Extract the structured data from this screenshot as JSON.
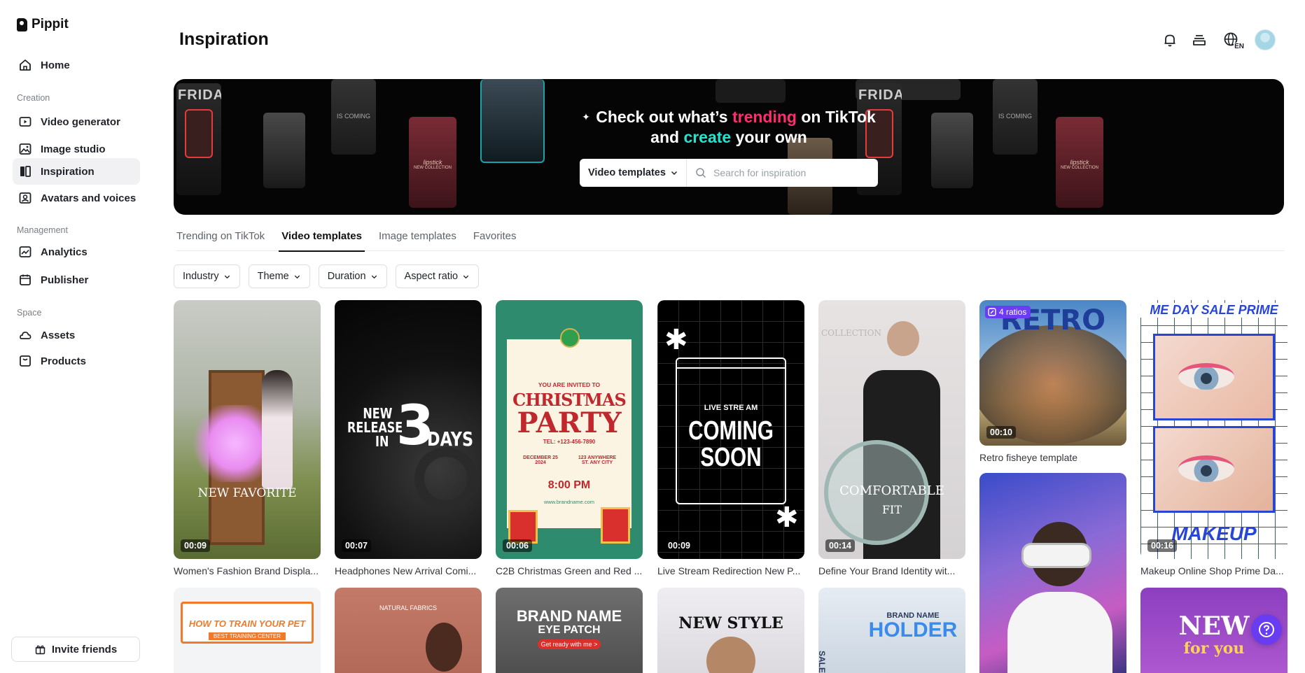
{
  "app": {
    "name": "Pippit"
  },
  "sidebar": {
    "home": "Home",
    "sections": {
      "creation": "Creation",
      "management": "Management",
      "space": "Space"
    },
    "creation_items": [
      "Video generator",
      "Image studio",
      "Inspiration",
      "Avatars and voices"
    ],
    "management_items": [
      "Analytics",
      "Publisher"
    ],
    "space_items": [
      "Assets",
      "Products"
    ],
    "invite_label": "Invite friends"
  },
  "header": {
    "title": "Inspiration",
    "language": "EN"
  },
  "banner": {
    "line1_pre": "Check out what’s ",
    "line1_highlight": "trending",
    "line1_post": " on TikTok",
    "line2_pre": "and ",
    "line2_highlight": "create",
    "line2_post": " your own",
    "search_select": "Video templates",
    "search_placeholder": "Search for inspiration",
    "tile_texts": {
      "friday": "FRIDAY",
      "coming": "IS COMING",
      "lipstick": "lipstick",
      "collection": "NEW COLLECTION"
    }
  },
  "tabs": [
    "Trending on TikTok",
    "Video templates",
    "Image templates",
    "Favorites"
  ],
  "active_tab": "Video templates",
  "filters": [
    "Industry",
    "Theme",
    "Duration",
    "Aspect ratio"
  ],
  "cards": [
    {
      "caption": "Women's Fashion Brand Displa...",
      "duration": "00:09",
      "text": "NEW FAVORITE"
    },
    {
      "caption": "Headphones New Arrival Comi...",
      "duration": "00:07",
      "text_a": "NEW",
      "text_b": "RELEASE",
      "text_c": "IN",
      "text_d": "3",
      "text_e": "DAYS"
    },
    {
      "caption": "C2B Christmas Green and Red ...",
      "duration": "00:06",
      "invite": "YOU ARE INVITED TO",
      "title1": "CHRISTMAS",
      "title2": "PARTY",
      "tel": "TEL: +123-456-7890",
      "date": "DECEMBER 25 2024",
      "addr": "123 ANYWHERE ST. ANY CITY",
      "time": "8:00 PM",
      "site": "www.brandname.com"
    },
    {
      "caption": "Live Stream Redirection New P...",
      "duration": "00:09",
      "small": "LIVE STRE AM",
      "big1": "COMING",
      "big2": "SOON"
    },
    {
      "caption": "Define Your Brand Identity wit...",
      "duration": "00:14",
      "text1": "COMFORTABLE",
      "text2": "FIT",
      "bg": "COLLECTION"
    },
    {
      "caption": "Retro fisheye template",
      "duration": "00:10",
      "badge": "4 ratios",
      "title": "RETRO"
    },
    {
      "caption": "Makeup Online Shop Prime Da...",
      "duration": "00:16",
      "top": "ME DAY SALE PRIME",
      "bottom": "MAKEUP"
    }
  ],
  "row2": {
    "pet_title": "HOW TO TRAIN YOUR PET",
    "pet_sub": "BEST TRAINING CENTER",
    "fabrics": "NATURAL FABRICS",
    "brand1": "BRAND NAME",
    "brand2": "EYE PATCH",
    "brand3": "Get ready with me >",
    "newstyle": "NEW STYLE",
    "holder1": "BRAND NAME",
    "holder2": "HOLDER",
    "sale": "SALE",
    "newfor1": "NEW",
    "newfor2": "for you"
  }
}
